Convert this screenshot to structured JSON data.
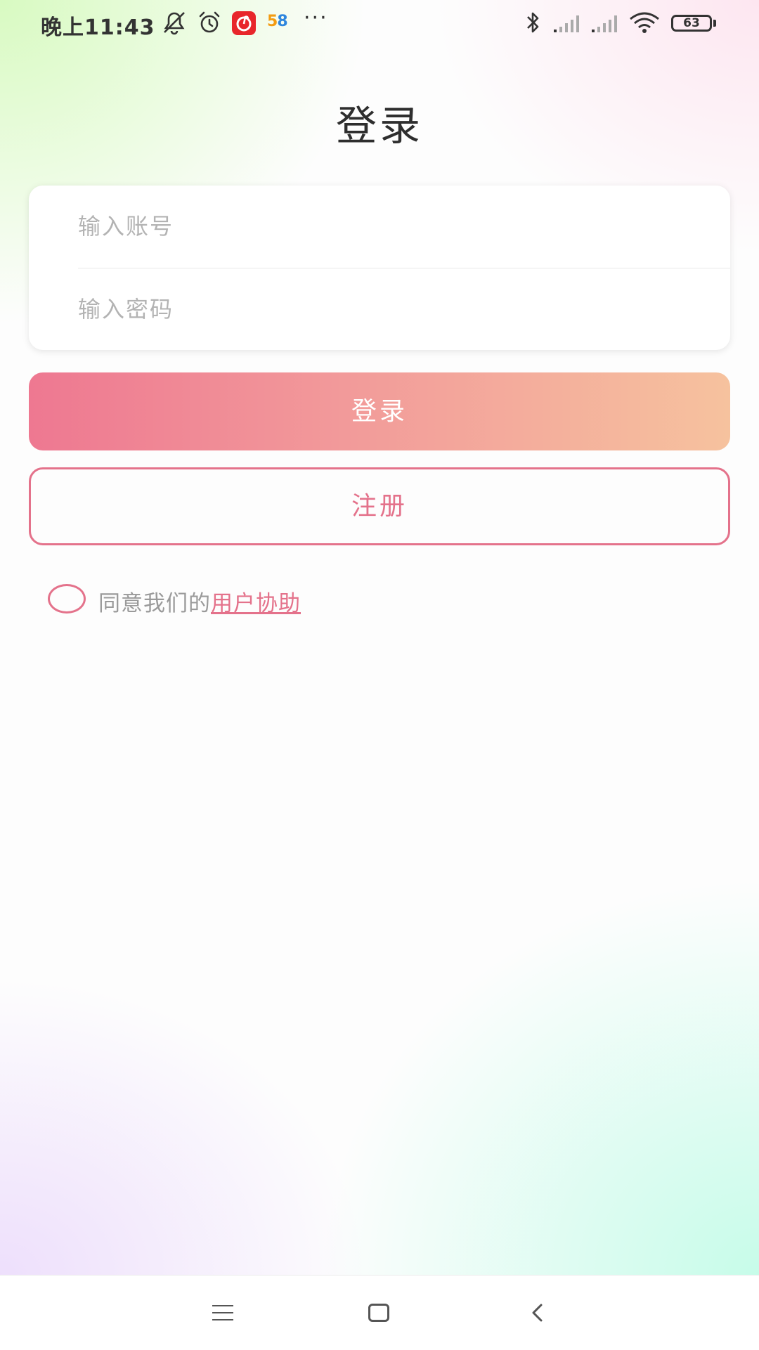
{
  "status_bar": {
    "time": "晚上11:43",
    "notification_icons": [
      "notification-muted-icon",
      "alarm-clock-icon",
      "netease-music-app-icon",
      "58-app-icon",
      "more-notifications-icon"
    ],
    "app_58_label_a": "5",
    "app_58_label_b": "8",
    "more": "···",
    "battery": "63",
    "system_icons": [
      "bluetooth-icon",
      "signal-icon",
      "signal-icon",
      "wifi-icon",
      "battery-icon"
    ]
  },
  "page": {
    "title": "登录"
  },
  "form": {
    "account_placeholder": "输入账号",
    "account_value": "",
    "password_placeholder": "输入密码",
    "password_value": ""
  },
  "buttons": {
    "login_label": "登录",
    "register_label": "注册"
  },
  "agreement": {
    "checked": false,
    "text": "同意我们的",
    "link_text": "用户协助"
  },
  "nav_bar": {
    "icons": [
      "menu-icon",
      "home-icon",
      "back-icon"
    ]
  },
  "colors": {
    "accent": "#e4728b",
    "login_gradient_start": "#ee7891",
    "login_gradient_end": "#f6c29e",
    "title_text": "#2e2e2e",
    "placeholder_text": "#b3b3b3"
  }
}
